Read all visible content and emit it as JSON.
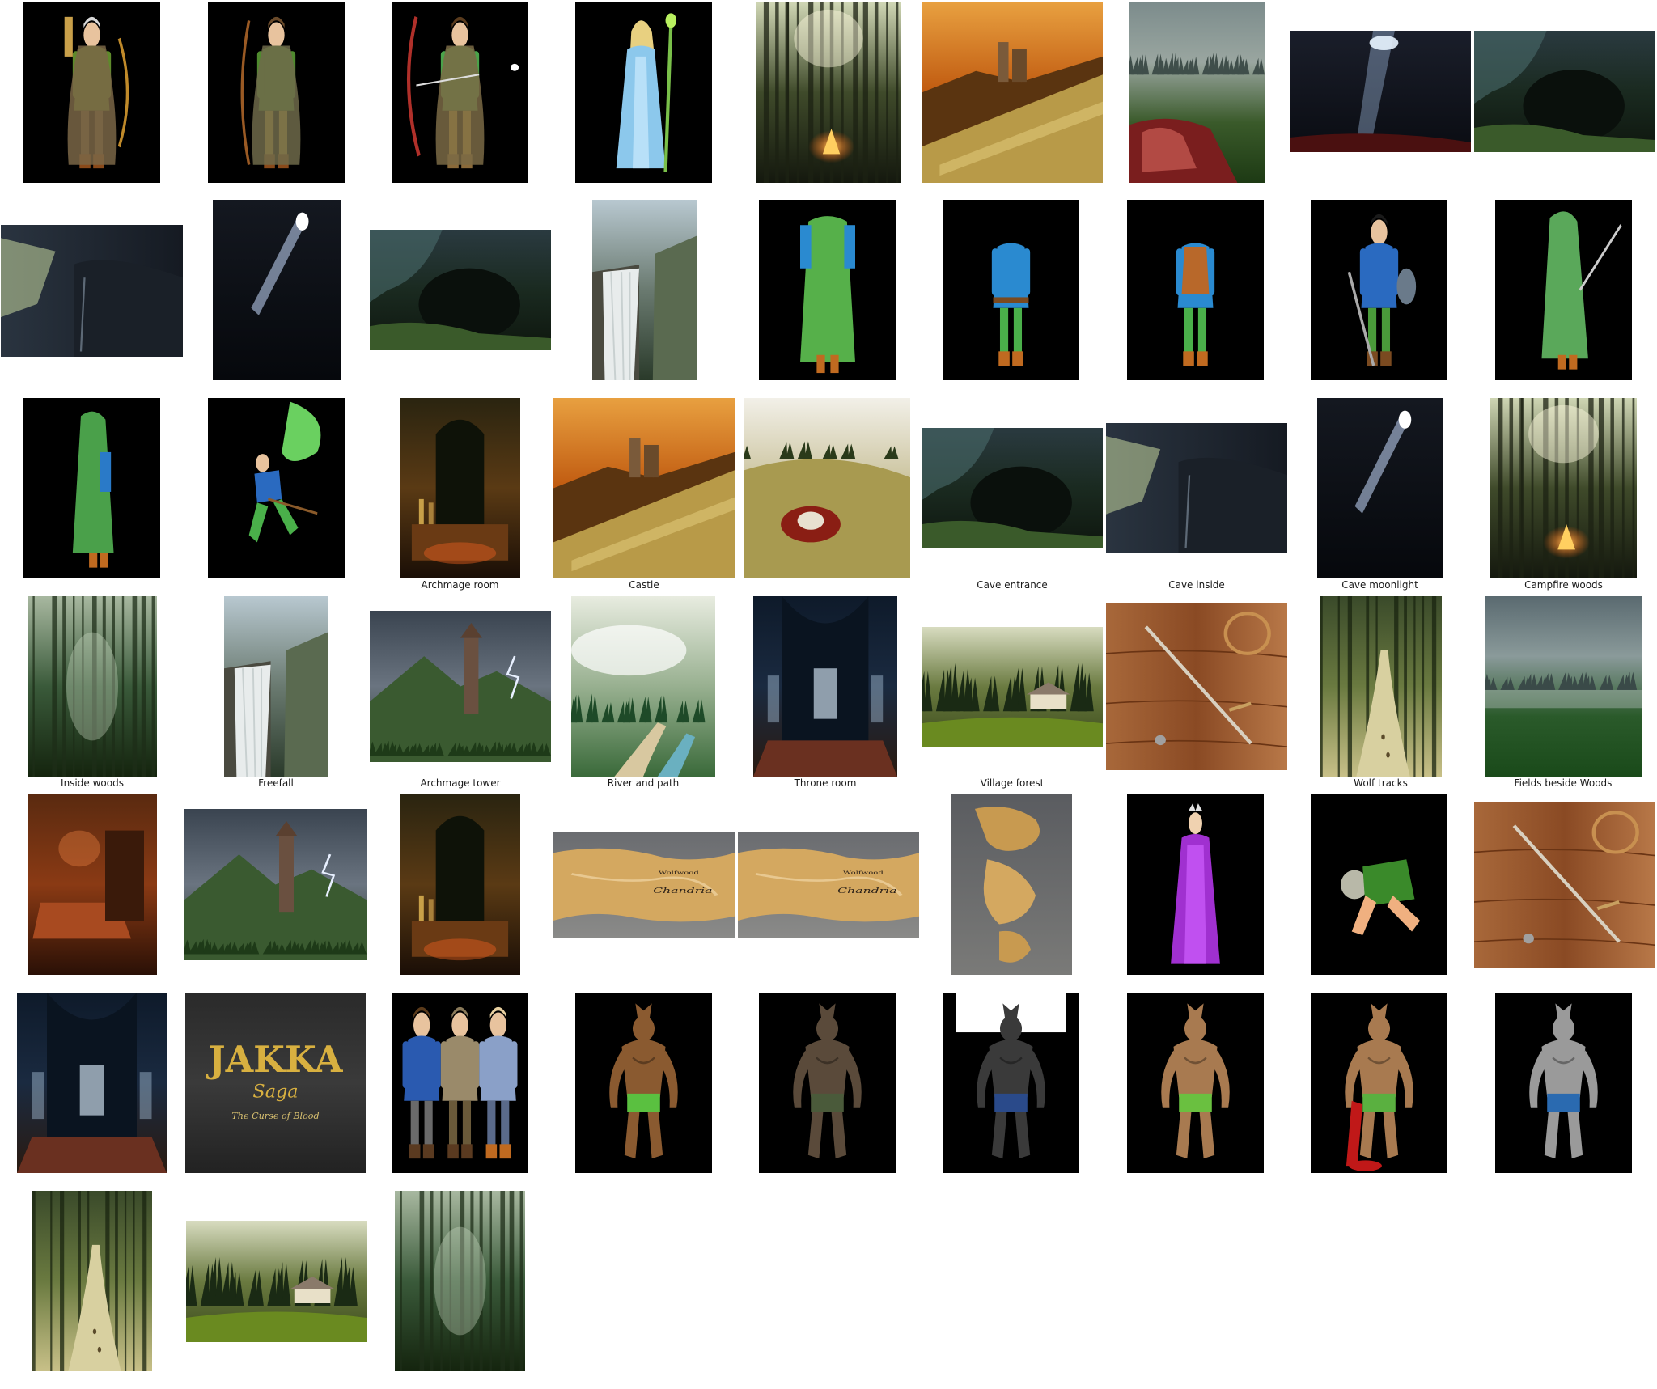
{
  "gallery": {
    "captions": [
      "Archmage room",
      "Castle",
      "Cave entrance",
      "Cave inside",
      "Cave moonlight",
      "Campfire woods",
      "Inside woods",
      "Freefall",
      "Archmage tower",
      "River and path",
      "Throne room",
      "Village forest",
      "Wolf tracks",
      "Fields beside Woods"
    ],
    "logo_text": "JAKKA Saga The Curse of Blood",
    "map_labels": [
      "Chandria",
      "Wolfwood"
    ],
    "thumbnails": [
      {
        "kind": "character-ranger-back",
        "row": 1
      },
      {
        "kind": "character-ranger-bow",
        "row": 1
      },
      {
        "kind": "character-archer-drawing",
        "row": 1
      },
      {
        "kind": "character-queen-staff",
        "row": 1
      },
      {
        "kind": "scene-forest-campfire",
        "row": 1
      },
      {
        "kind": "scene-castle-sunset",
        "row": 1
      },
      {
        "kind": "scene-fog-carcass",
        "row": 1
      },
      {
        "kind": "scene-cave-light",
        "row": 1
      },
      {
        "kind": "scene-cave-entrance",
        "row": 1
      },
      {
        "kind": "scene-cave-inside",
        "row": 2
      },
      {
        "kind": "scene-cave-moonlight",
        "row": 2
      },
      {
        "kind": "scene-cave-entrance",
        "row": 2
      },
      {
        "kind": "scene-waterfall",
        "row": 2
      },
      {
        "kind": "costume-green-cloak",
        "row": 2
      },
      {
        "kind": "costume-blue-tunic",
        "row": 2
      },
      {
        "kind": "costume-leather-vest",
        "row": 2
      },
      {
        "kind": "character-knight-blue",
        "row": 2
      },
      {
        "kind": "character-hooded-sword",
        "row": 2
      },
      {
        "kind": "character-hooded-back",
        "row": 3
      },
      {
        "kind": "character-leaping-cape",
        "row": 3
      },
      {
        "kind": "scene-archmage-room",
        "row": 3,
        "caption": 0
      },
      {
        "kind": "scene-castle-sunset",
        "row": 3,
        "caption": 1
      },
      {
        "kind": "scene-meadow-carcass",
        "row": 3
      },
      {
        "kind": "scene-cave-entrance",
        "row": 3,
        "caption": 2
      },
      {
        "kind": "scene-cave-inside",
        "row": 3,
        "caption": 3
      },
      {
        "kind": "scene-cave-moonlight",
        "row": 3,
        "caption": 4
      },
      {
        "kind": "scene-forest-campfire",
        "row": 3,
        "caption": 5
      },
      {
        "kind": "scene-inside-woods",
        "row": 4,
        "caption": 6
      },
      {
        "kind": "scene-waterfall",
        "row": 4,
        "caption": 7
      },
      {
        "kind": "scene-tower-storm",
        "row": 4,
        "caption": 8
      },
      {
        "kind": "scene-river-path",
        "row": 4,
        "caption": 9
      },
      {
        "kind": "scene-throne-room",
        "row": 4,
        "caption": 10
      },
      {
        "kind": "scene-village-forest",
        "row": 4,
        "caption": 11
      },
      {
        "kind": "prop-sword-table",
        "row": 4
      },
      {
        "kind": "scene-wolf-tracks",
        "row": 4,
        "caption": 12
      },
      {
        "kind": "scene-fields-fog",
        "row": 4,
        "caption": 13
      },
      {
        "kind": "scene-bedroom",
        "row": 5
      },
      {
        "kind": "scene-tower-storm",
        "row": 5
      },
      {
        "kind": "scene-archmage-room",
        "row": 5
      },
      {
        "kind": "map-region-a",
        "row": 5
      },
      {
        "kind": "map-region-b",
        "row": 5
      },
      {
        "kind": "map-world",
        "row": 5
      },
      {
        "kind": "character-purple-queen",
        "row": 5
      },
      {
        "kind": "character-crawling",
        "row": 5
      },
      {
        "kind": "prop-sword-table",
        "row": 5
      },
      {
        "kind": "scene-throne-room",
        "row": 6
      },
      {
        "kind": "logo-title",
        "row": 6
      },
      {
        "kind": "characters-villagers",
        "row": 6
      },
      {
        "kind": "creature-werewolf-brown",
        "row": 6
      },
      {
        "kind": "creature-werewolf-dark",
        "row": 6
      },
      {
        "kind": "creature-werewolf-grey",
        "row": 6
      },
      {
        "kind": "creature-werewolf-side",
        "row": 6
      },
      {
        "kind": "creature-werewolf-bloody",
        "row": 6
      },
      {
        "kind": "creature-werewolf-silver",
        "row": 6
      },
      {
        "kind": "scene-wolf-tracks",
        "row": 7
      },
      {
        "kind": "scene-village-forest",
        "row": 7
      },
      {
        "kind": "scene-inside-woods",
        "row": 7
      }
    ]
  }
}
